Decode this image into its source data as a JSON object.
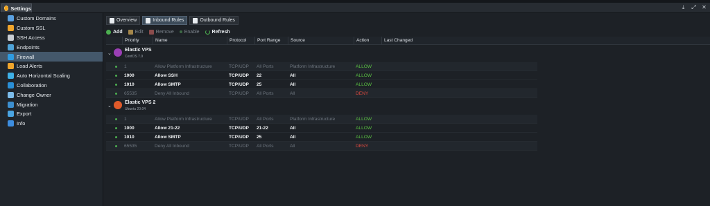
{
  "window": {
    "tab_label": "Settings",
    "controls": [
      "download-icon",
      "expand-icon",
      "close-icon"
    ]
  },
  "sidebar": {
    "items": [
      {
        "label": "Custom Domains",
        "icon": "globe-icon",
        "color": "#5aa0e0"
      },
      {
        "label": "Custom SSL",
        "icon": "ssl-icon",
        "color": "#f0a52c"
      },
      {
        "label": "SSH Access",
        "icon": "terminal-icon",
        "color": "#c9ced4"
      },
      {
        "label": "Endpoints",
        "icon": "endpoints-icon",
        "color": "#4fa3d8"
      },
      {
        "label": "Firewall",
        "icon": "firewall-icon",
        "color": "#2f9be0",
        "active": true
      },
      {
        "label": "Load Alerts",
        "icon": "alert-icon",
        "color": "#f0a52c"
      },
      {
        "label": "Auto Horizontal Scaling",
        "icon": "scaling-icon",
        "color": "#3fb0e6"
      },
      {
        "label": "Collaboration",
        "icon": "collaboration-icon",
        "color": "#2a8fd6"
      },
      {
        "label": "Change Owner",
        "icon": "owner-icon",
        "color": "#7cbcea"
      },
      {
        "label": "Migration",
        "icon": "migration-icon",
        "color": "#3c8fd0"
      },
      {
        "label": "Export",
        "icon": "export-icon",
        "color": "#4aa5e3"
      },
      {
        "label": "Info",
        "icon": "info-icon",
        "color": "#3d8ee0"
      }
    ]
  },
  "tabs": [
    {
      "label": "Overview",
      "active": false
    },
    {
      "label": "Inbound Rules",
      "active": true
    },
    {
      "label": "Outbound Rules",
      "active": false
    }
  ],
  "toolbar": {
    "add": "Add",
    "edit": "Edit",
    "remove": "Remove",
    "enable": "Enable",
    "refresh": "Refresh"
  },
  "columns": [
    "Priority",
    "Name",
    "Protocol",
    "Port Range",
    "Source",
    "Action",
    "Last Changed"
  ],
  "groups": [
    {
      "name": "Elastic VPS",
      "os": "CentOS 7.9",
      "icon_color": "#9b3fb5",
      "rows": [
        {
          "priority": "1",
          "name": "Allow Platform Infrastructure",
          "protocol": "TCP/UDP",
          "port": "All Ports",
          "source": "Platform Infrastructure",
          "action": "ALLOW",
          "style": "dim"
        },
        {
          "priority": "1000",
          "name": "Allow SSH",
          "protocol": "TCP/UDP",
          "port": "22",
          "source": "All",
          "action": "ALLOW",
          "style": "bright"
        },
        {
          "priority": "1010",
          "name": "Allow SMTP",
          "protocol": "TCP/UDP",
          "port": "25",
          "source": "All",
          "action": "ALLOW",
          "style": "bright"
        },
        {
          "priority": "65535",
          "name": "Deny All Inbound",
          "protocol": "TCP/UDP",
          "port": "All Ports",
          "source": "All",
          "action": "DENY",
          "style": "dim"
        }
      ]
    },
    {
      "name": "Elastic VPS 2",
      "os": "Ubuntu 20.04",
      "icon_color": "#e05a2a",
      "rows": [
        {
          "priority": "1",
          "name": "Allow Platform Infrastructure",
          "protocol": "TCP/UDP",
          "port": "All Ports",
          "source": "Platform Infrastructure",
          "action": "ALLOW",
          "style": "dim"
        },
        {
          "priority": "1000",
          "name": "Allow 21-22",
          "protocol": "TCP/UDP",
          "port": "21-22",
          "source": "All",
          "action": "ALLOW",
          "style": "bright"
        },
        {
          "priority": "1010",
          "name": "Allow SMTP",
          "protocol": "TCP/UDP",
          "port": "25",
          "source": "All",
          "action": "ALLOW",
          "style": "bright"
        },
        {
          "priority": "65535",
          "name": "Deny All Inbound",
          "protocol": "TCP/UDP",
          "port": "All Ports",
          "source": "All",
          "action": "DENY",
          "style": "dim"
        }
      ]
    }
  ]
}
